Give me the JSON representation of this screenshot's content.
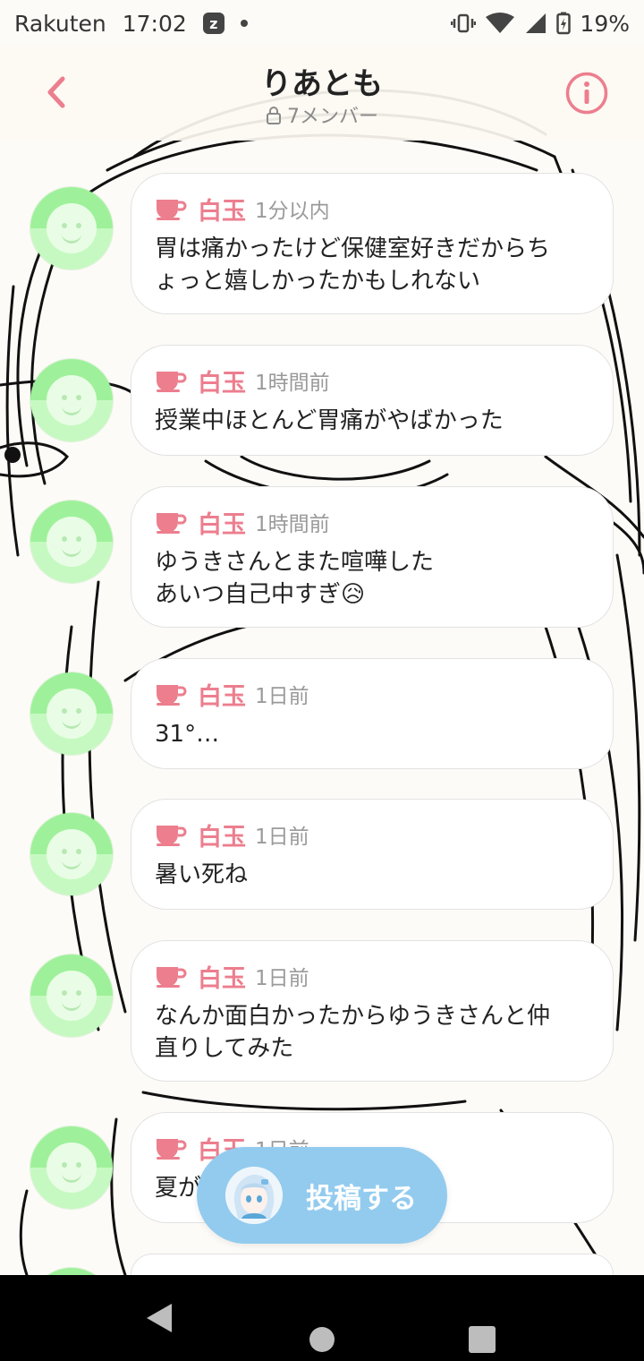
{
  "status_bar": {
    "carrier": "Rakuten",
    "time": "17:02",
    "battery": "19%"
  },
  "header": {
    "title": "りあとも",
    "members": "7メンバー"
  },
  "posts": [
    {
      "author": "白玉",
      "time": "1分以内",
      "text": "胃は痛かったけど保健室好きだからち\nょっと嬉しかったかもしれない"
    },
    {
      "author": "白玉",
      "time": "1時間前",
      "text": "授業中ほとんど胃痛がやばかった"
    },
    {
      "author": "白玉",
      "time": "1時間前",
      "text": "ゆうきさんとまた喧嘩した\nあいつ自己中すぎ😥"
    },
    {
      "author": "白玉",
      "time": "1日前",
      "text": "31°…"
    },
    {
      "author": "白玉",
      "time": "1日前",
      "text": "暑い死ね"
    },
    {
      "author": "白玉",
      "time": "1日前",
      "text": "なんか面白かったからゆうきさんと仲\n直りしてみた"
    },
    {
      "author": "白玉",
      "time": "1日前",
      "text": "夏が"
    }
  ],
  "post_button": {
    "label": "投稿する"
  },
  "colors": {
    "accent_pink": "#ec7e8e",
    "post_button": "#93cbef",
    "avatar_green": "#9ef19a"
  },
  "icons": {
    "back": "chevron-left-icon",
    "info": "info-icon",
    "lock": "lock-icon",
    "cup": "teacup-icon"
  }
}
